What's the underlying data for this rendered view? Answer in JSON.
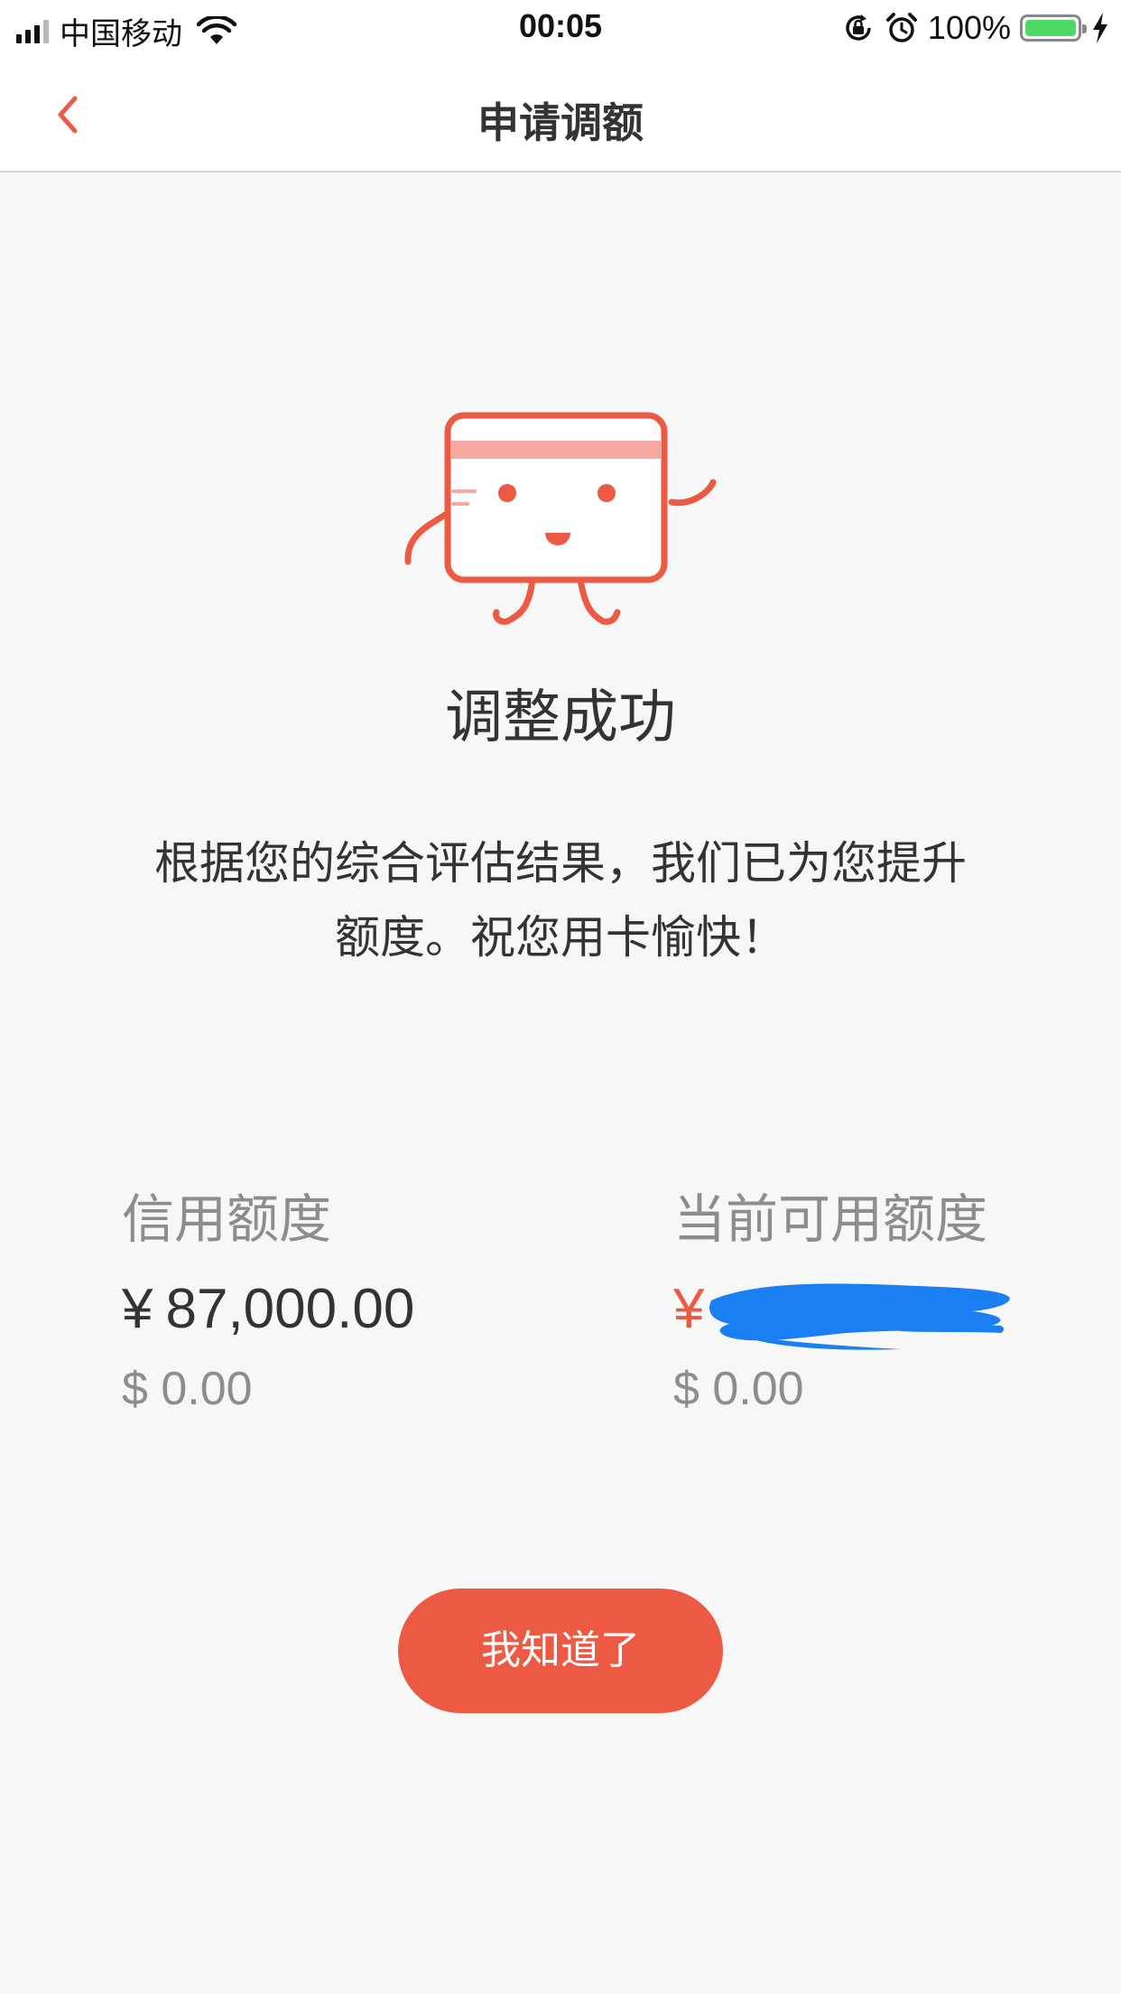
{
  "status_bar": {
    "carrier": "中国移动",
    "time": "00:05",
    "battery_percent": "100%",
    "battery_level": 1.0,
    "icons": [
      "signal-icon",
      "wifi-icon",
      "rotation-lock-icon",
      "alarm-icon",
      "battery-icon",
      "charging-icon"
    ]
  },
  "nav": {
    "title": "申请调额",
    "back_icon": "chevron-left-icon"
  },
  "result": {
    "mascot": "card-mascot-illustration",
    "title": "调整成功",
    "message": "根据您的综合评估结果，我们已为您提升额度。祝您用卡愉快！"
  },
  "limits": {
    "credit": {
      "label": "信用额度",
      "cny_symbol": "¥",
      "cny_value": "87,000.00",
      "usd_value": "$ 0.00"
    },
    "available": {
      "label": "当前可用额度",
      "cny_symbol": "¥",
      "usd_value": "$ 0.00"
    }
  },
  "actions": {
    "confirm_label": "我知道了"
  },
  "colors": {
    "accent": "#ec5a44",
    "background": "#f7f7f7",
    "redaction": "#1a7ff2",
    "battery": "#4cd964"
  }
}
